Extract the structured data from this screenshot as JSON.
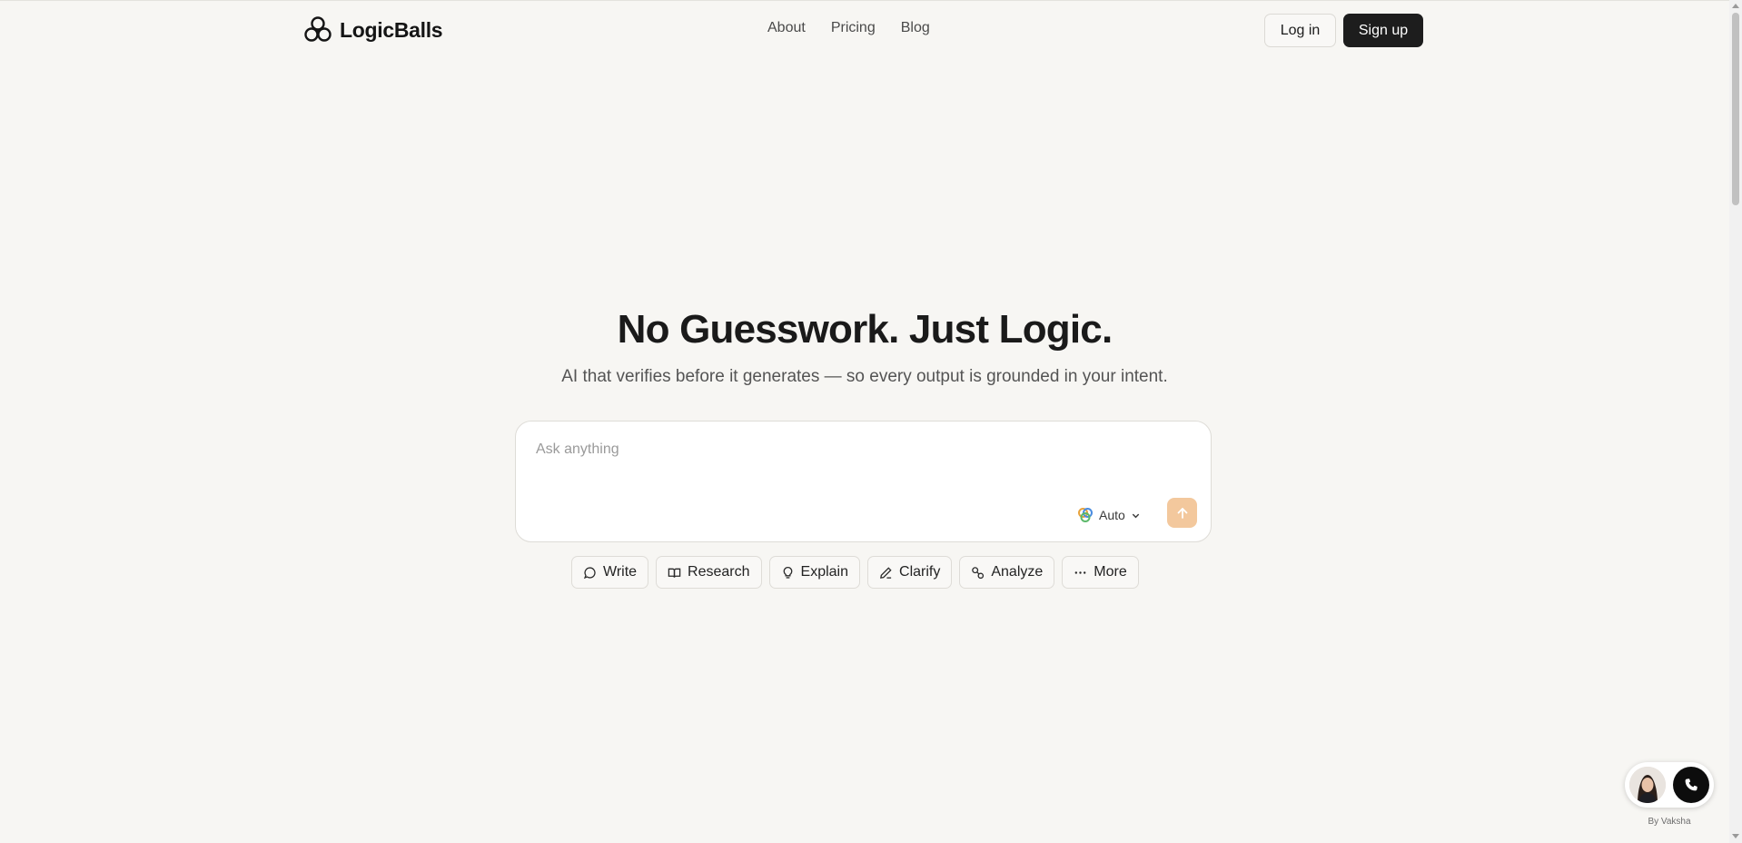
{
  "header": {
    "logo_text": "LogicBalls",
    "nav": [
      "About",
      "Pricing",
      "Blog"
    ],
    "login_label": "Log in",
    "signup_label": "Sign up"
  },
  "hero": {
    "title": "No Guesswork. Just Logic.",
    "subtitle": "AI that verifies before it generates — so every output is grounded in your intent."
  },
  "prompt": {
    "placeholder": "Ask anything",
    "value": "",
    "model_label": "Auto",
    "model_icon": "multicolor-model-icon",
    "send_icon": "arrow-up-icon"
  },
  "chips": [
    {
      "label": "Write",
      "icon": "chat-bubble-icon"
    },
    {
      "label": "Research",
      "icon": "book-open-icon"
    },
    {
      "label": "Explain",
      "icon": "lightbulb-icon"
    },
    {
      "label": "Clarify",
      "icon": "pencil-icon"
    },
    {
      "label": "Analyze",
      "icon": "shapes-icon"
    },
    {
      "label": "More",
      "icon": "ellipsis-icon"
    }
  ],
  "voice_widget": {
    "credit": "By Vaksha",
    "call_icon": "phone-icon"
  },
  "colors": {
    "background": "#f7f6f3",
    "primary_button": "#1d1d1d",
    "send_button": "#f3c89d"
  }
}
